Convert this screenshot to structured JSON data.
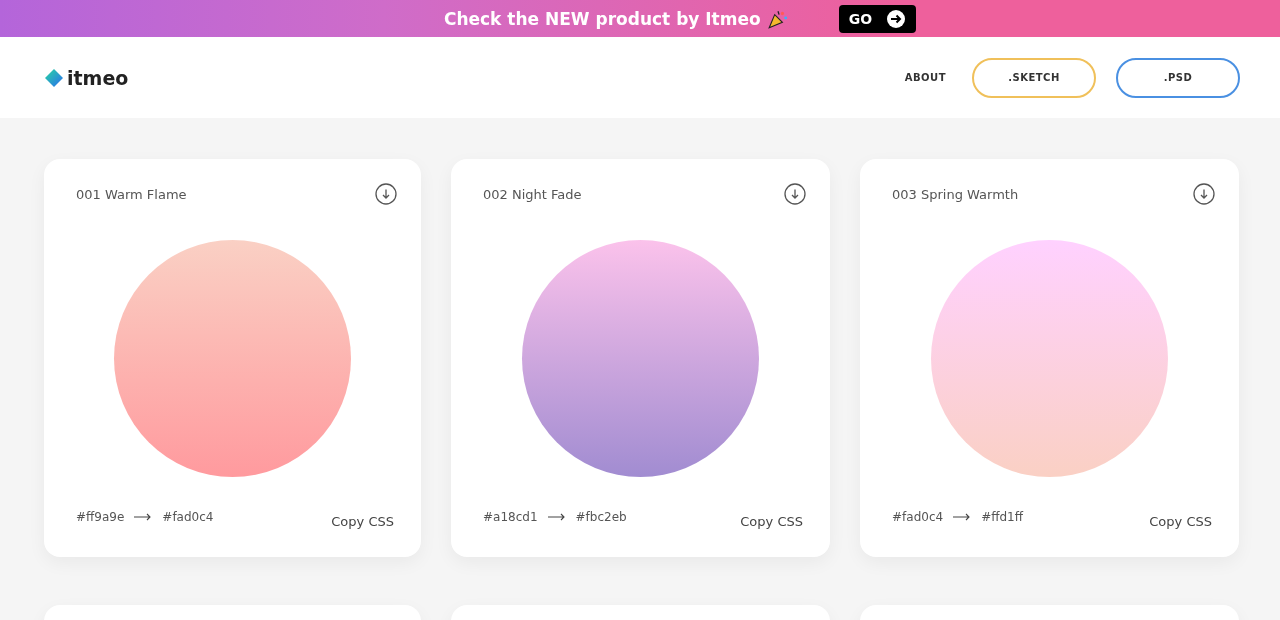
{
  "banner": {
    "text": "Check the NEW product by Itmeo",
    "button": "GO"
  },
  "header": {
    "logo": "itmeo",
    "nav": [
      {
        "label": "ABOUT",
        "kind": "link"
      },
      {
        "label": ".SKETCH",
        "kind": "outline",
        "color": "#f0c05a"
      },
      {
        "label": ".PSD",
        "kind": "outline",
        "color": "#4a90e2"
      }
    ]
  },
  "cards": [
    {
      "title": "001 Warm Flame",
      "from": "#ff9a9e",
      "to": "#fad0c4",
      "action": "Copy CSS"
    },
    {
      "title": "002 Night Fade",
      "from": "#a18cd1",
      "to": "#fbc2eb",
      "action": "Copy CSS"
    },
    {
      "title": "003 Spring Warmth",
      "from": "#fad0c4",
      "to": "#ffd1ff",
      "action": "Copy CSS"
    }
  ],
  "next_row": [
    {
      "kind": "card"
    },
    {
      "kind": "card"
    },
    {
      "kind": "card"
    }
  ]
}
